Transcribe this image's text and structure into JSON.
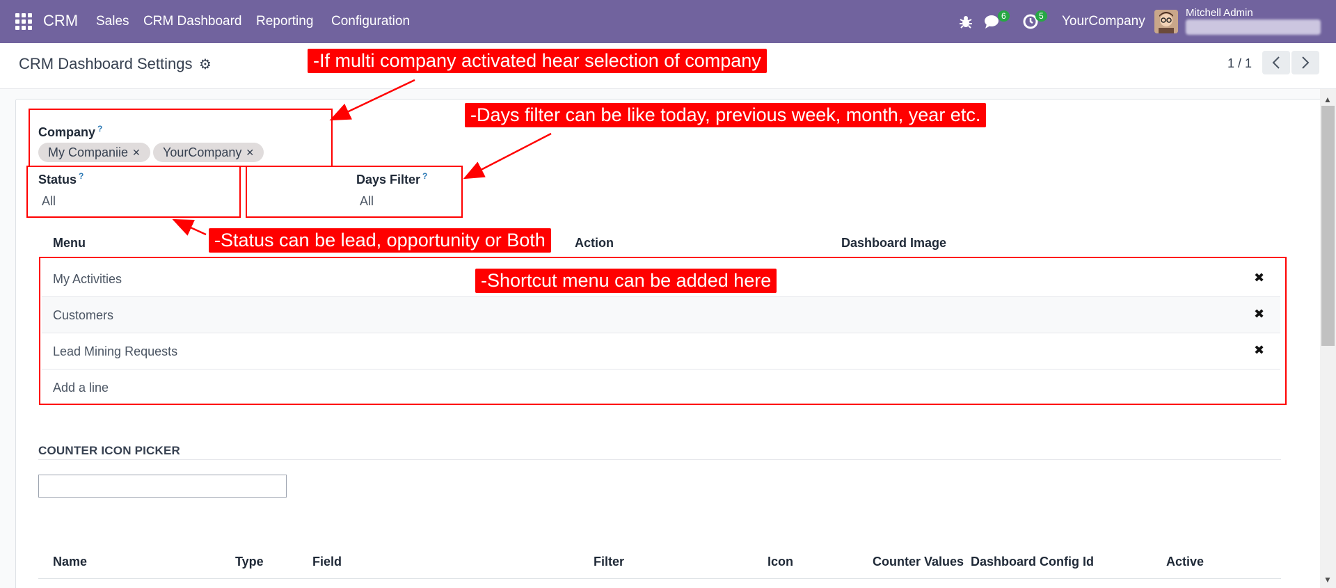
{
  "nav": {
    "brand": "CRM",
    "items": [
      "Sales",
      "CRM Dashboard",
      "Reporting",
      "Configuration"
    ],
    "messages_count": "6",
    "activities_count": "5",
    "company": "YourCompany",
    "user": "Mitchell Admin"
  },
  "control": {
    "breadcrumb": "CRM Dashboard Settings",
    "pager": "1 / 1"
  },
  "form": {
    "company_label": "Company",
    "company_tags": [
      "My Companiie",
      "YourCompany"
    ],
    "status_label": "Status",
    "status_value": "All",
    "days_filter_label": "Days Filter",
    "days_filter_value": "All",
    "help_mark": "?"
  },
  "menu_table": {
    "headers": [
      "Menu",
      "Action",
      "Dashboard Image"
    ],
    "rows": [
      "My Activities",
      "Customers",
      "Lead Mining Requests"
    ],
    "add_line": "Add a line"
  },
  "counter_section": {
    "title": "COUNTER ICON PICKER",
    "input_value": ""
  },
  "counter_table": {
    "headers": [
      "Name",
      "Type",
      "Field",
      "Filter",
      "Icon",
      "Counter Values",
      "Dashboard Config Id",
      "Active"
    ]
  },
  "annotations": {
    "company_note": "-If multi company activated hear selection of company",
    "days_note": "-Days filter can be like today, previous week, month, year etc.",
    "status_note": "-Status can be lead, opportunity or Both",
    "shortcut_note": "-Shortcut menu can be added here"
  },
  "icons": {
    "apps": "apps-grid-icon",
    "bug": "bug-icon",
    "chat": "chat-icon",
    "clock": "clock-icon",
    "gear": "gear-icon",
    "delete": "close-icon"
  },
  "colors": {
    "navbar": "#71639e",
    "annotation": "#ff0000",
    "badge": "#27a745"
  }
}
